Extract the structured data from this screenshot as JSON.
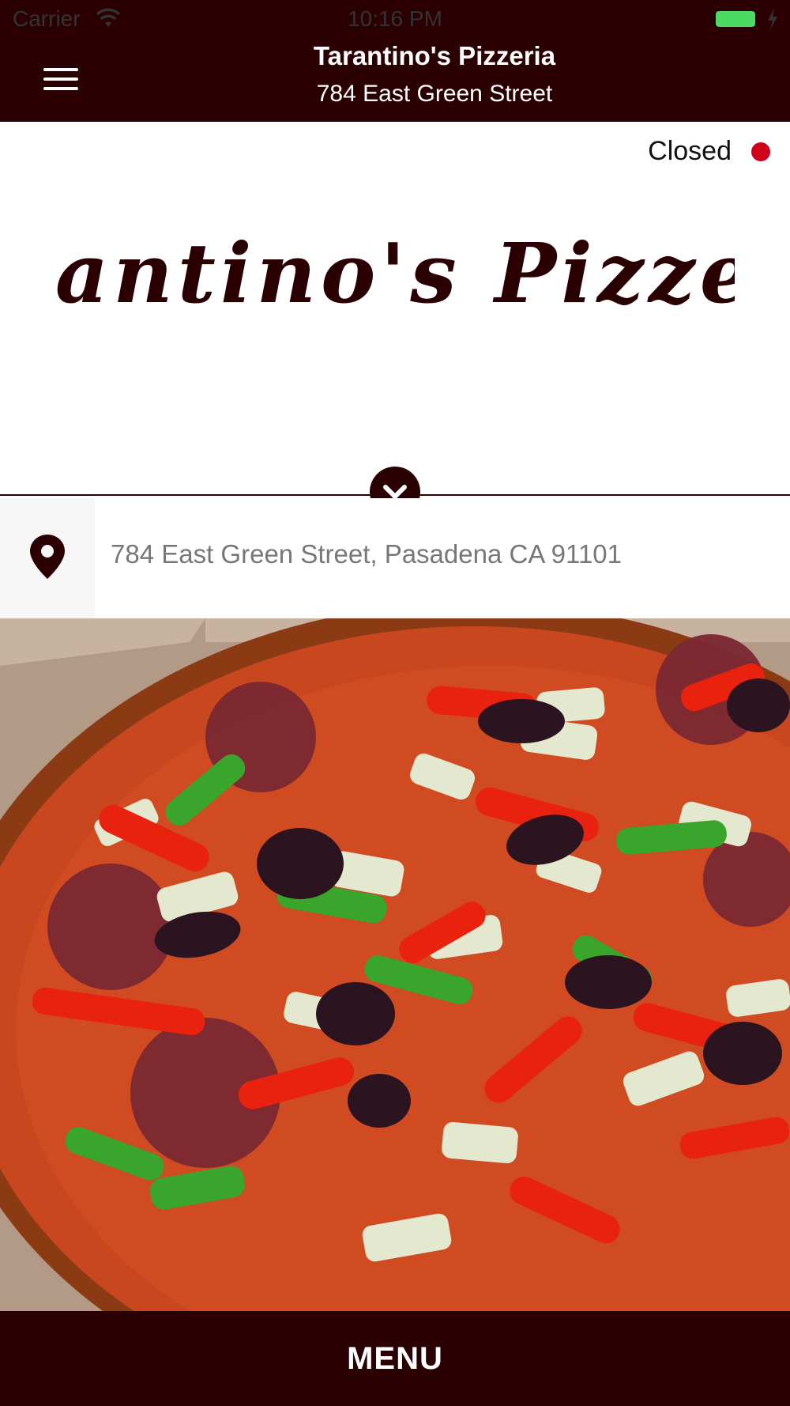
{
  "status_bar": {
    "carrier": "Carrier",
    "time": "10:16 PM"
  },
  "header": {
    "title": "Tarantino's Pizzeria",
    "subtitle": "784 East Green Street",
    "menu_icon": "hamburger-icon"
  },
  "restaurant": {
    "status": "Closed",
    "status_color": "#d0021b",
    "logo_text": "Tarantino's Pizzeria",
    "address": "784 East Green Street, Pasadena CA 91101",
    "address_icon": "location-pin-icon",
    "expand_icon": "chevron-down-icon"
  },
  "footer": {
    "menu_label": "MENU"
  },
  "colors": {
    "brand": "#2a0003",
    "closed": "#d0021b",
    "battery": "#4cd964"
  }
}
